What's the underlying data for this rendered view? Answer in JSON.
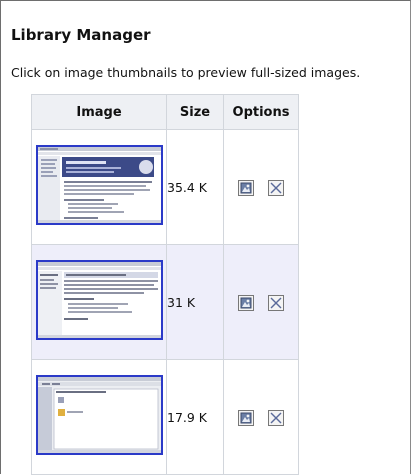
{
  "title": "Library Manager",
  "subtitle": "Click on image thumbnails to preview full-sized images.",
  "table": {
    "headers": [
      "Image",
      "Size",
      "Options"
    ],
    "rows": [
      {
        "size": "35.4 K",
        "thumbnail_icon": "screenshot-thumbnail"
      },
      {
        "size": "31 K",
        "thumbnail_icon": "screenshot-thumbnail"
      },
      {
        "size": "17.9 K",
        "thumbnail_icon": "screenshot-thumbnail"
      }
    ]
  },
  "icons": {
    "insert": "insert-image-icon",
    "delete": "delete-icon"
  },
  "colors": {
    "thumb_border": "#2b3ac8",
    "header_bg": "#eef0f4",
    "alt_row_bg": "#eeeefa"
  }
}
